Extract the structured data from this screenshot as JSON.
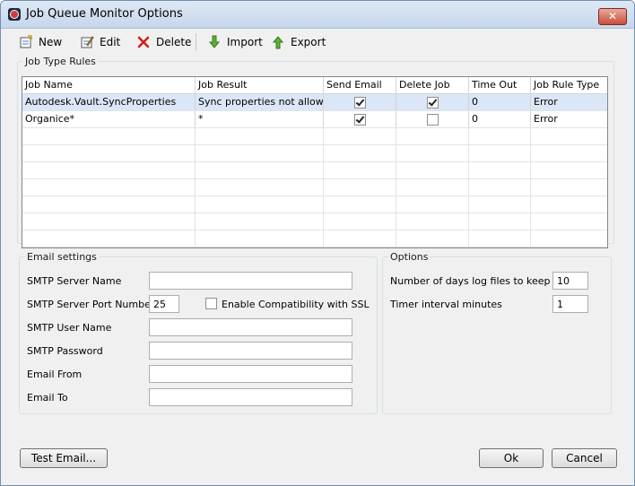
{
  "window": {
    "title": "Job Queue Monitor Options",
    "close_label": "✕"
  },
  "toolbar": {
    "new": "New",
    "edit": "Edit",
    "delete": "Delete",
    "import": "Import",
    "export": "Export"
  },
  "job_type_rules": {
    "legend": "Job Type Rules",
    "columns": [
      "Job Name",
      "Job Result",
      "Send Email",
      "Delete Job",
      "Time Out",
      "Job Rule Type"
    ],
    "rows": [
      {
        "job_name": "Autodesk.Vault.SyncProperties",
        "job_result": "Sync properties not allow…",
        "send_email": true,
        "delete_job": true,
        "time_out": "0",
        "rule_type": "Error"
      },
      {
        "job_name": "Organice*",
        "job_result": "*",
        "send_email": true,
        "delete_job": false,
        "time_out": "0",
        "rule_type": "Error"
      }
    ]
  },
  "email_settings": {
    "legend": "Email settings",
    "smtp_server_name_label": "SMTP Server Name",
    "smtp_server_name_value": "",
    "smtp_port_label": "SMTP Server Port Number",
    "smtp_port_value": "25",
    "ssl_label": "Enable Compatibility with SSL",
    "smtp_user_label": "SMTP User Name",
    "smtp_user_value": "",
    "smtp_password_label": "SMTP Password",
    "smtp_password_value": "",
    "email_from_label": "Email From",
    "email_from_value": "",
    "email_to_label": "Email To",
    "email_to_value": ""
  },
  "options": {
    "legend": "Options",
    "log_days_label": "Number of days log files to keep",
    "log_days_value": "10",
    "timer_label": "Timer interval minutes",
    "timer_value": "1"
  },
  "buttons": {
    "test_email": "Test Email...",
    "ok": "Ok",
    "cancel": "Cancel"
  }
}
